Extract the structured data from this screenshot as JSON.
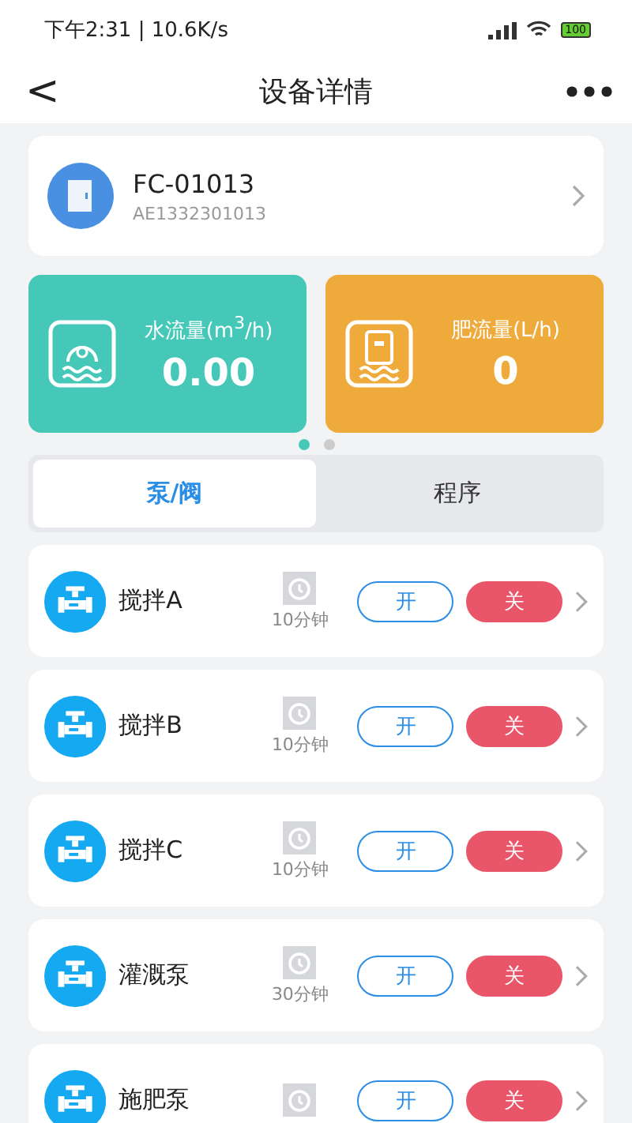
{
  "status_bar": {
    "time": "下午2:31 | 10.6K/s",
    "battery": "100"
  },
  "header": {
    "back": "<",
    "title": "设备详情"
  },
  "device": {
    "name": "FC-01013",
    "serial": "AE1332301013"
  },
  "flow_cards": [
    {
      "kind": "water",
      "label": "水流量(m$^{3}$/h)",
      "value": "0.00",
      "color": "#45c8b8"
    },
    {
      "kind": "fertilizer",
      "label": "肥流量(L/h)",
      "value": "0",
      "color": "#eeab3c"
    }
  ],
  "pager": [
    {
      "selected": true
    },
    {
      "selected": false
    }
  ],
  "tabs": [
    {
      "label": "泵/阀",
      "selected": true
    },
    {
      "label": "程序",
      "selected": false
    }
  ],
  "pumps": [
    {
      "name": "搅拌A",
      "duration": "10分钟",
      "open_label": "开",
      "close_label": "关",
      "on": false
    },
    {
      "name": "搅拌B",
      "duration": "10分钟",
      "open_label": "开",
      "close_label": "关",
      "on": false
    },
    {
      "name": "搅拌C",
      "duration": "10分钟",
      "open_label": "开",
      "close_label": "关",
      "on": false
    },
    {
      "name": "灌溉泵",
      "duration": "30分钟",
      "open_label": "开",
      "close_label": "关",
      "on": false
    },
    {
      "name": "施肥泵",
      "open_label": "开",
      "close_label": "关",
      "on": false
    }
  ]
}
